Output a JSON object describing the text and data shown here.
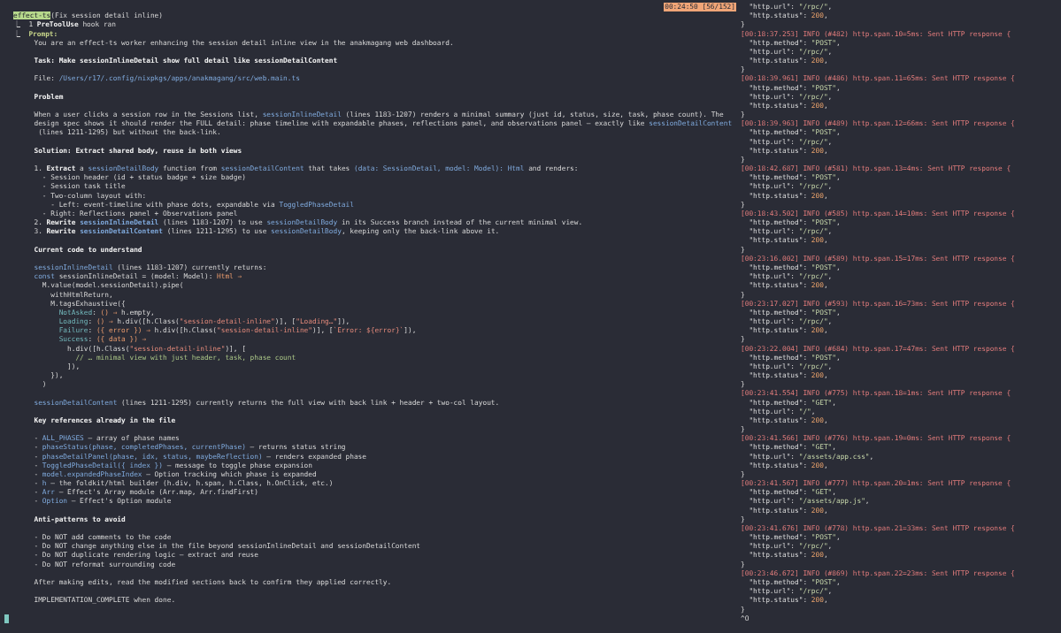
{
  "prompt_pane": {
    "status_badge": "00:24:50 [56/152]",
    "lines": [
      {
        "kind": "text",
        "parts": [
          {
            "text": "effect-ts",
            "kind": "highlight"
          },
          {
            "text": "(Fix session detail inline)",
            "kind": "plain"
          }
        ]
      },
      {
        "kind": "text",
        "parts": [
          {
            "text": "⎿  1 ",
            "kind": "plain"
          },
          {
            "text": "PreToolUse",
            "kind": "bold"
          },
          {
            "text": " hook ran",
            "kind": "plain"
          }
        ]
      },
      {
        "kind": "text",
        "parts": [
          {
            "text": "⎿  ",
            "kind": "plain"
          },
          {
            "text": "Prompt:",
            "kind": "prompt"
          }
        ]
      },
      {
        "kind": "text",
        "parts": [
          {
            "text": "     You are an effect-ts worker enhancing the session detail inline view in the anakmagang web dashboard.",
            "kind": "plain"
          }
        ]
      },
      {
        "kind": "blank"
      },
      {
        "kind": "text",
        "parts": [
          {
            "text": "     Task: Make sessionInlineDetail show full detail like sessionDetailContent",
            "kind": "bold"
          }
        ]
      },
      {
        "kind": "blank"
      },
      {
        "kind": "text",
        "parts": [
          {
            "text": "     File: ",
            "kind": "plain"
          },
          {
            "text": "/Users/r17/.config/nixpkgs/apps/anakmagang/src/web.main.ts",
            "kind": "ident"
          }
        ]
      },
      {
        "kind": "blank"
      },
      {
        "kind": "text",
        "parts": [
          {
            "text": "     Problem",
            "kind": "bold"
          }
        ]
      },
      {
        "kind": "blank"
      },
      {
        "kind": "text",
        "parts": [
          {
            "text": "     When a user clicks a session row in the Sessions list, ",
            "kind": "plain"
          },
          {
            "text": "sessionInlineDetail",
            "kind": "ident"
          },
          {
            "text": " (lines 1183-1207) renders a minimal summary (just id, status, size, task, phase count). The",
            "kind": "plain"
          }
        ]
      },
      {
        "kind": "text",
        "parts": [
          {
            "text": "     design spec shows it should render the FULL detail: phase timeline with expandable phases, reflections panel, and observations panel — exactly like ",
            "kind": "plain"
          },
          {
            "text": "sessionDetailContent",
            "kind": "ident"
          }
        ]
      },
      {
        "kind": "text",
        "parts": [
          {
            "text": "      (lines 1211-1295) but without the back-link.",
            "kind": "plain"
          }
        ]
      },
      {
        "kind": "blank"
      },
      {
        "kind": "text",
        "parts": [
          {
            "text": "     Solution: Extract shared body, reuse in both views",
            "kind": "bold"
          }
        ]
      },
      {
        "kind": "blank"
      },
      {
        "kind": "text",
        "parts": [
          {
            "text": "     1. ",
            "kind": "plain"
          },
          {
            "text": "Extract",
            "kind": "bold"
          },
          {
            "text": " a ",
            "kind": "plain"
          },
          {
            "text": "sessionDetailBody",
            "kind": "ident"
          },
          {
            "text": " function from ",
            "kind": "plain"
          },
          {
            "text": "sessionDetailContent",
            "kind": "ident"
          },
          {
            "text": " that takes ",
            "kind": "plain"
          },
          {
            "text": "(data: SessionDetail, model: Model): Html",
            "kind": "ident"
          },
          {
            "text": " and renders:",
            "kind": "plain"
          }
        ]
      },
      {
        "kind": "text",
        "parts": [
          {
            "text": "       - Session header (id + status badge + size badge)",
            "kind": "plain"
          }
        ]
      },
      {
        "kind": "text",
        "parts": [
          {
            "text": "       - Session task title",
            "kind": "plain"
          }
        ]
      },
      {
        "kind": "text",
        "parts": [
          {
            "text": "       - Two-column layout with:",
            "kind": "plain"
          }
        ]
      },
      {
        "kind": "text",
        "parts": [
          {
            "text": "         - Left: event-timeline with phase dots, expandable via ",
            "kind": "plain"
          },
          {
            "text": "ToggledPhaseDetail",
            "kind": "ident"
          }
        ]
      },
      {
        "kind": "text",
        "parts": [
          {
            "text": "       - Right: Reflections panel + Observations panel",
            "kind": "plain"
          }
        ]
      },
      {
        "kind": "text",
        "parts": [
          {
            "text": "     2. ",
            "kind": "plain"
          },
          {
            "text": "Rewrite ",
            "kind": "bold"
          },
          {
            "text": "sessionInlineDetail",
            "kind": "ident_bold"
          },
          {
            "text": " (lines 1183-1207) to use ",
            "kind": "plain"
          },
          {
            "text": "sessionDetailBody",
            "kind": "ident"
          },
          {
            "text": " in its Success branch instead of the current minimal view.",
            "kind": "plain"
          }
        ]
      },
      {
        "kind": "text",
        "parts": [
          {
            "text": "     3. ",
            "kind": "plain"
          },
          {
            "text": "Rewrite ",
            "kind": "bold"
          },
          {
            "text": "sessionDetailContent",
            "kind": "ident_bold"
          },
          {
            "text": " (lines 1211-1295) to use ",
            "kind": "plain"
          },
          {
            "text": "sessionDetailBody",
            "kind": "ident"
          },
          {
            "text": ", keeping only the back-link above it.",
            "kind": "plain"
          }
        ]
      },
      {
        "kind": "blank"
      },
      {
        "kind": "text",
        "parts": [
          {
            "text": "     Current code to understand",
            "kind": "bold"
          }
        ]
      },
      {
        "kind": "blank"
      },
      {
        "kind": "text",
        "parts": [
          {
            "text": "     sessionInlineDetail",
            "kind": "ident"
          },
          {
            "text": " (lines 1183-1207) currently returns:",
            "kind": "plain"
          }
        ]
      },
      {
        "kind": "text",
        "parts": [
          {
            "text": "     const",
            "kind": "ident"
          },
          {
            "text": " sessionInlineDetail = (model: Model): ",
            "kind": "plain"
          },
          {
            "text": "Html ⇒",
            "kind": "arrow"
          }
        ]
      },
      {
        "kind": "text",
        "parts": [
          {
            "text": "       M.value(model.sessionDetail).pipe(",
            "kind": "plain"
          }
        ]
      },
      {
        "kind": "text",
        "parts": [
          {
            "text": "         withHtmlReturn,",
            "kind": "plain"
          }
        ]
      },
      {
        "kind": "text",
        "parts": [
          {
            "text": "         M.tagsExhaustive({",
            "kind": "plain"
          }
        ]
      },
      {
        "kind": "text",
        "parts": [
          {
            "text": "           NotAsked",
            "kind": "tag"
          },
          {
            "text": ": ",
            "kind": "plain"
          },
          {
            "text": "() ⇒",
            "kind": "arrow"
          },
          {
            "text": " h.empty,",
            "kind": "plain"
          }
        ]
      },
      {
        "kind": "text",
        "parts": [
          {
            "text": "           Loading",
            "kind": "tag"
          },
          {
            "text": ": ",
            "kind": "plain"
          },
          {
            "text": "() ⇒",
            "kind": "arrow"
          },
          {
            "text": " h.div([h.Class(",
            "kind": "plain"
          },
          {
            "text": "\"session-detail-inline\"",
            "kind": "string"
          },
          {
            "text": ")], [",
            "kind": "plain"
          },
          {
            "text": "\"Loading…\"",
            "kind": "string"
          },
          {
            "text": "]),",
            "kind": "plain"
          }
        ]
      },
      {
        "kind": "text",
        "parts": [
          {
            "text": "           Failure",
            "kind": "tag"
          },
          {
            "text": ": ",
            "kind": "plain"
          },
          {
            "text": "({ error }) ⇒",
            "kind": "arrow"
          },
          {
            "text": " h.div([h.Class(",
            "kind": "plain"
          },
          {
            "text": "\"session-detail-inline\"",
            "kind": "string"
          },
          {
            "text": ")], [",
            "kind": "plain"
          },
          {
            "text": "`Error: ${error}`",
            "kind": "string"
          },
          {
            "text": "]),",
            "kind": "plain"
          }
        ]
      },
      {
        "kind": "text",
        "parts": [
          {
            "text": "           Success",
            "kind": "tag"
          },
          {
            "text": ": ",
            "kind": "plain"
          },
          {
            "text": "({ data }) ⇒",
            "kind": "arrow"
          }
        ]
      },
      {
        "kind": "text",
        "parts": [
          {
            "text": "             h.div([h.Class(",
            "kind": "plain"
          },
          {
            "text": "\"session-detail-inline\"",
            "kind": "string"
          },
          {
            "text": ")], [",
            "kind": "plain"
          }
        ]
      },
      {
        "kind": "text",
        "parts": [
          {
            "text": "               // … minimal view with just header, task, phase count",
            "kind": "comment"
          }
        ]
      },
      {
        "kind": "text",
        "parts": [
          {
            "text": "             ]),",
            "kind": "plain"
          }
        ]
      },
      {
        "kind": "text",
        "parts": [
          {
            "text": "         }),",
            "kind": "plain"
          }
        ]
      },
      {
        "kind": "text",
        "parts": [
          {
            "text": "       )",
            "kind": "plain"
          }
        ]
      },
      {
        "kind": "blank"
      },
      {
        "kind": "text",
        "parts": [
          {
            "text": "     sessionDetailContent",
            "kind": "ident"
          },
          {
            "text": " (lines 1211-1295) currently returns the full view with back link + header + two-col layout.",
            "kind": "plain"
          }
        ]
      },
      {
        "kind": "blank"
      },
      {
        "kind": "text",
        "parts": [
          {
            "text": "     Key references already in the file",
            "kind": "bold"
          }
        ]
      },
      {
        "kind": "blank"
      },
      {
        "kind": "text",
        "parts": [
          {
            "text": "     - ",
            "kind": "plain"
          },
          {
            "text": "ALL_PHASES",
            "kind": "ident"
          },
          {
            "text": " — array of phase names",
            "kind": "plain"
          }
        ]
      },
      {
        "kind": "text",
        "parts": [
          {
            "text": "     - ",
            "kind": "plain"
          },
          {
            "text": "phaseStatus(phase, completedPhases, currentPhase)",
            "kind": "ident"
          },
          {
            "text": " — returns status string",
            "kind": "plain"
          }
        ]
      },
      {
        "kind": "text",
        "parts": [
          {
            "text": "     - ",
            "kind": "plain"
          },
          {
            "text": "phaseDetailPanel(phase, idx, status, maybeReflection)",
            "kind": "ident"
          },
          {
            "text": " — renders expanded phase",
            "kind": "plain"
          }
        ]
      },
      {
        "kind": "text",
        "parts": [
          {
            "text": "     - ",
            "kind": "plain"
          },
          {
            "text": "ToggledPhaseDetail({ index })",
            "kind": "ident"
          },
          {
            "text": " — message to toggle phase expansion",
            "kind": "plain"
          }
        ]
      },
      {
        "kind": "text",
        "parts": [
          {
            "text": "     - ",
            "kind": "plain"
          },
          {
            "text": "model.expandedPhaseIndex",
            "kind": "ident"
          },
          {
            "text": " — Option tracking which phase is expanded",
            "kind": "plain"
          }
        ]
      },
      {
        "kind": "text",
        "parts": [
          {
            "text": "     - ",
            "kind": "plain"
          },
          {
            "text": "h",
            "kind": "ident"
          },
          {
            "text": " — the foldkit/html builder (h.div, h.span, h.Class, h.OnClick, etc.)",
            "kind": "plain"
          }
        ]
      },
      {
        "kind": "text",
        "parts": [
          {
            "text": "     - ",
            "kind": "plain"
          },
          {
            "text": "Arr",
            "kind": "ident"
          },
          {
            "text": " — Effect's Array module (Arr.map, Arr.findFirst)",
            "kind": "plain"
          }
        ]
      },
      {
        "kind": "text",
        "parts": [
          {
            "text": "     - ",
            "kind": "plain"
          },
          {
            "text": "Option",
            "kind": "ident"
          },
          {
            "text": " — Effect's Option module",
            "kind": "plain"
          }
        ]
      },
      {
        "kind": "blank"
      },
      {
        "kind": "text",
        "parts": [
          {
            "text": "     Anti-patterns to avoid",
            "kind": "bold"
          }
        ]
      },
      {
        "kind": "blank"
      },
      {
        "kind": "text",
        "parts": [
          {
            "text": "     - Do NOT add comments to the code",
            "kind": "plain"
          }
        ]
      },
      {
        "kind": "text",
        "parts": [
          {
            "text": "     - Do NOT change anything else in the file beyond sessionInlineDetail and sessionDetailContent",
            "kind": "plain"
          }
        ]
      },
      {
        "kind": "text",
        "parts": [
          {
            "text": "     - Do NOT duplicate rendering logic — extract and reuse",
            "kind": "plain"
          }
        ]
      },
      {
        "kind": "text",
        "parts": [
          {
            "text": "     - Do NOT reformat surrounding code",
            "kind": "plain"
          }
        ]
      },
      {
        "kind": "blank"
      },
      {
        "kind": "text",
        "parts": [
          {
            "text": "     After making edits, read the modified sections back to confirm they applied correctly.",
            "kind": "plain"
          }
        ]
      },
      {
        "kind": "blank"
      },
      {
        "kind": "text",
        "parts": [
          {
            "text": "     IMPLEMENTATION_COMPLETE when done.",
            "kind": "plain"
          }
        ]
      },
      {
        "kind": "blank"
      },
      {
        "kind": "cursor"
      }
    ]
  },
  "log_pane": {
    "lines": [
      {
        "kind": "text",
        "parts": [
          {
            "text": "  \"http.url\": ",
            "kind": "key"
          },
          {
            "text": "\"/rpc/\"",
            "kind": "value"
          },
          {
            "text": ",",
            "kind": "plain"
          }
        ]
      },
      {
        "kind": "text",
        "parts": [
          {
            "text": "  \"http.status\": ",
            "kind": "key"
          },
          {
            "text": "200",
            "kind": "number"
          },
          {
            "text": ",",
            "kind": "plain"
          }
        ]
      },
      {
        "kind": "text",
        "parts": [
          {
            "text": "}",
            "kind": "plain"
          }
        ]
      },
      {
        "kind": "text",
        "parts": [
          {
            "text": "[00:18:37.253] INFO (#482) http.span.10=5ms: Sent HTTP response {",
            "kind": "log_head"
          }
        ]
      },
      {
        "kind": "text",
        "parts": [
          {
            "text": "  \"http.method\": ",
            "kind": "key"
          },
          {
            "text": "\"POST\"",
            "kind": "value"
          },
          {
            "text": ",",
            "kind": "plain"
          }
        ]
      },
      {
        "kind": "text",
        "parts": [
          {
            "text": "  \"http.url\": ",
            "kind": "key"
          },
          {
            "text": "\"/rpc/\"",
            "kind": "value"
          },
          {
            "text": ",",
            "kind": "plain"
          }
        ]
      },
      {
        "kind": "text",
        "parts": [
          {
            "text": "  \"http.status\": ",
            "kind": "key"
          },
          {
            "text": "200",
            "kind": "number"
          },
          {
            "text": ",",
            "kind": "plain"
          }
        ]
      },
      {
        "kind": "text",
        "parts": [
          {
            "text": "}",
            "kind": "plain"
          }
        ]
      },
      {
        "kind": "text",
        "parts": [
          {
            "text": "[00:18:39.961] INFO (#486) http.span.11=65ms: Sent HTTP response {",
            "kind": "log_head"
          }
        ]
      },
      {
        "kind": "text",
        "parts": [
          {
            "text": "  \"http.method\": ",
            "kind": "key"
          },
          {
            "text": "\"POST\"",
            "kind": "value"
          },
          {
            "text": ",",
            "kind": "plain"
          }
        ]
      },
      {
        "kind": "text",
        "parts": [
          {
            "text": "  \"http.url\": ",
            "kind": "key"
          },
          {
            "text": "\"/rpc/\"",
            "kind": "value"
          },
          {
            "text": ",",
            "kind": "plain"
          }
        ]
      },
      {
        "kind": "text",
        "parts": [
          {
            "text": "  \"http.status\": ",
            "kind": "key"
          },
          {
            "text": "200",
            "kind": "number"
          },
          {
            "text": ",",
            "kind": "plain"
          }
        ]
      },
      {
        "kind": "text",
        "parts": [
          {
            "text": "}",
            "kind": "plain"
          }
        ]
      },
      {
        "kind": "text",
        "parts": [
          {
            "text": "[00:18:39.963] INFO (#489) http.span.12=66ms: Sent HTTP response {",
            "kind": "log_head"
          }
        ]
      },
      {
        "kind": "text",
        "parts": [
          {
            "text": "  \"http.method\": ",
            "kind": "key"
          },
          {
            "text": "\"POST\"",
            "kind": "value"
          },
          {
            "text": ",",
            "kind": "plain"
          }
        ]
      },
      {
        "kind": "text",
        "parts": [
          {
            "text": "  \"http.url\": ",
            "kind": "key"
          },
          {
            "text": "\"/rpc/\"",
            "kind": "value"
          },
          {
            "text": ",",
            "kind": "plain"
          }
        ]
      },
      {
        "kind": "text",
        "parts": [
          {
            "text": "  \"http.status\": ",
            "kind": "key"
          },
          {
            "text": "200",
            "kind": "number"
          },
          {
            "text": ",",
            "kind": "plain"
          }
        ]
      },
      {
        "kind": "text",
        "parts": [
          {
            "text": "}",
            "kind": "plain"
          }
        ]
      },
      {
        "kind": "text",
        "parts": [
          {
            "text": "[00:18:42.687] INFO (#581) http.span.13=4ms: Sent HTTP response {",
            "kind": "log_head"
          }
        ]
      },
      {
        "kind": "text",
        "parts": [
          {
            "text": "  \"http.method\": ",
            "kind": "key"
          },
          {
            "text": "\"POST\"",
            "kind": "value"
          },
          {
            "text": ",",
            "kind": "plain"
          }
        ]
      },
      {
        "kind": "text",
        "parts": [
          {
            "text": "  \"http.url\": ",
            "kind": "key"
          },
          {
            "text": "\"/rpc/\"",
            "kind": "value"
          },
          {
            "text": ",",
            "kind": "plain"
          }
        ]
      },
      {
        "kind": "text",
        "parts": [
          {
            "text": "  \"http.status\": ",
            "kind": "key"
          },
          {
            "text": "200",
            "kind": "number"
          },
          {
            "text": ",",
            "kind": "plain"
          }
        ]
      },
      {
        "kind": "text",
        "parts": [
          {
            "text": "}",
            "kind": "plain"
          }
        ]
      },
      {
        "kind": "text",
        "parts": [
          {
            "text": "[00:18:43.502] INFO (#585) http.span.14=10ms: Sent HTTP response {",
            "kind": "log_head"
          }
        ]
      },
      {
        "kind": "text",
        "parts": [
          {
            "text": "  \"http.method\": ",
            "kind": "key"
          },
          {
            "text": "\"POST\"",
            "kind": "value"
          },
          {
            "text": ",",
            "kind": "plain"
          }
        ]
      },
      {
        "kind": "text",
        "parts": [
          {
            "text": "  \"http.url\": ",
            "kind": "key"
          },
          {
            "text": "\"/rpc/\"",
            "kind": "value"
          },
          {
            "text": ",",
            "kind": "plain"
          }
        ]
      },
      {
        "kind": "text",
        "parts": [
          {
            "text": "  \"http.status\": ",
            "kind": "key"
          },
          {
            "text": "200",
            "kind": "number"
          },
          {
            "text": ",",
            "kind": "plain"
          }
        ]
      },
      {
        "kind": "text",
        "parts": [
          {
            "text": "}",
            "kind": "plain"
          }
        ]
      },
      {
        "kind": "text",
        "parts": [
          {
            "text": "[00:23:16.002] INFO (#589) http.span.15=17ms: Sent HTTP response {",
            "kind": "log_head"
          }
        ]
      },
      {
        "kind": "text",
        "parts": [
          {
            "text": "  \"http.method\": ",
            "kind": "key"
          },
          {
            "text": "\"POST\"",
            "kind": "value"
          },
          {
            "text": ",",
            "kind": "plain"
          }
        ]
      },
      {
        "kind": "text",
        "parts": [
          {
            "text": "  \"http.url\": ",
            "kind": "key"
          },
          {
            "text": "\"/rpc/\"",
            "kind": "value"
          },
          {
            "text": ",",
            "kind": "plain"
          }
        ]
      },
      {
        "kind": "text",
        "parts": [
          {
            "text": "  \"http.status\": ",
            "kind": "key"
          },
          {
            "text": "200",
            "kind": "number"
          },
          {
            "text": ",",
            "kind": "plain"
          }
        ]
      },
      {
        "kind": "text",
        "parts": [
          {
            "text": "}",
            "kind": "plain"
          }
        ]
      },
      {
        "kind": "text",
        "parts": [
          {
            "text": "[00:23:17.027] INFO (#593) http.span.16=73ms: Sent HTTP response {",
            "kind": "log_head"
          }
        ]
      },
      {
        "kind": "text",
        "parts": [
          {
            "text": "  \"http.method\": ",
            "kind": "key"
          },
          {
            "text": "\"POST\"",
            "kind": "value"
          },
          {
            "text": ",",
            "kind": "plain"
          }
        ]
      },
      {
        "kind": "text",
        "parts": [
          {
            "text": "  \"http.url\": ",
            "kind": "key"
          },
          {
            "text": "\"/rpc/\"",
            "kind": "value"
          },
          {
            "text": ",",
            "kind": "plain"
          }
        ]
      },
      {
        "kind": "text",
        "parts": [
          {
            "text": "  \"http.status\": ",
            "kind": "key"
          },
          {
            "text": "200",
            "kind": "number"
          },
          {
            "text": ",",
            "kind": "plain"
          }
        ]
      },
      {
        "kind": "text",
        "parts": [
          {
            "text": "}",
            "kind": "plain"
          }
        ]
      },
      {
        "kind": "text",
        "parts": [
          {
            "text": "[00:23:22.004] INFO (#684) http.span.17=47ms: Sent HTTP response {",
            "kind": "log_head"
          }
        ]
      },
      {
        "kind": "text",
        "parts": [
          {
            "text": "  \"http.method\": ",
            "kind": "key"
          },
          {
            "text": "\"POST\"",
            "kind": "value"
          },
          {
            "text": ",",
            "kind": "plain"
          }
        ]
      },
      {
        "kind": "text",
        "parts": [
          {
            "text": "  \"http.url\": ",
            "kind": "key"
          },
          {
            "text": "\"/rpc/\"",
            "kind": "value"
          },
          {
            "text": ",",
            "kind": "plain"
          }
        ]
      },
      {
        "kind": "text",
        "parts": [
          {
            "text": "  \"http.status\": ",
            "kind": "key"
          },
          {
            "text": "200",
            "kind": "number"
          },
          {
            "text": ",",
            "kind": "plain"
          }
        ]
      },
      {
        "kind": "text",
        "parts": [
          {
            "text": "}",
            "kind": "plain"
          }
        ]
      },
      {
        "kind": "text",
        "parts": [
          {
            "text": "[00:23:41.554] INFO (#775) http.span.18=1ms: Sent HTTP response {",
            "kind": "log_head"
          }
        ]
      },
      {
        "kind": "text",
        "parts": [
          {
            "text": "  \"http.method\": ",
            "kind": "key"
          },
          {
            "text": "\"GET\"",
            "kind": "value"
          },
          {
            "text": ",",
            "kind": "plain"
          }
        ]
      },
      {
        "kind": "text",
        "parts": [
          {
            "text": "  \"http.url\": ",
            "kind": "key"
          },
          {
            "text": "\"/\"",
            "kind": "value"
          },
          {
            "text": ",",
            "kind": "plain"
          }
        ]
      },
      {
        "kind": "text",
        "parts": [
          {
            "text": "  \"http.status\": ",
            "kind": "key"
          },
          {
            "text": "200",
            "kind": "number"
          },
          {
            "text": ",",
            "kind": "plain"
          }
        ]
      },
      {
        "kind": "text",
        "parts": [
          {
            "text": "}",
            "kind": "plain"
          }
        ]
      },
      {
        "kind": "text",
        "parts": [
          {
            "text": "[00:23:41.566] INFO (#776) http.span.19=0ms: Sent HTTP response {",
            "kind": "log_head"
          }
        ]
      },
      {
        "kind": "text",
        "parts": [
          {
            "text": "  \"http.method\": ",
            "kind": "key"
          },
          {
            "text": "\"GET\"",
            "kind": "value"
          },
          {
            "text": ",",
            "kind": "plain"
          }
        ]
      },
      {
        "kind": "text",
        "parts": [
          {
            "text": "  \"http.url\": ",
            "kind": "key"
          },
          {
            "text": "\"/assets/app.css\"",
            "kind": "value"
          },
          {
            "text": ",",
            "kind": "plain"
          }
        ]
      },
      {
        "kind": "text",
        "parts": [
          {
            "text": "  \"http.status\": ",
            "kind": "key"
          },
          {
            "text": "200",
            "kind": "number"
          },
          {
            "text": ",",
            "kind": "plain"
          }
        ]
      },
      {
        "kind": "text",
        "parts": [
          {
            "text": "}",
            "kind": "plain"
          }
        ]
      },
      {
        "kind": "text",
        "parts": [
          {
            "text": "[00:23:41.567] INFO (#777) http.span.20=1ms: Sent HTTP response {",
            "kind": "log_head"
          }
        ]
      },
      {
        "kind": "text",
        "parts": [
          {
            "text": "  \"http.method\": ",
            "kind": "key"
          },
          {
            "text": "\"GET\"",
            "kind": "value"
          },
          {
            "text": ",",
            "kind": "plain"
          }
        ]
      },
      {
        "kind": "text",
        "parts": [
          {
            "text": "  \"http.url\": ",
            "kind": "key"
          },
          {
            "text": "\"/assets/app.js\"",
            "kind": "value"
          },
          {
            "text": ",",
            "kind": "plain"
          }
        ]
      },
      {
        "kind": "text",
        "parts": [
          {
            "text": "  \"http.status\": ",
            "kind": "key"
          },
          {
            "text": "200",
            "kind": "number"
          },
          {
            "text": ",",
            "kind": "plain"
          }
        ]
      },
      {
        "kind": "text",
        "parts": [
          {
            "text": "}",
            "kind": "plain"
          }
        ]
      },
      {
        "kind": "text",
        "parts": [
          {
            "text": "[00:23:41.676] INFO (#778) http.span.21=33ms: Sent HTTP response {",
            "kind": "log_head"
          }
        ]
      },
      {
        "kind": "text",
        "parts": [
          {
            "text": "  \"http.method\": ",
            "kind": "key"
          },
          {
            "text": "\"POST\"",
            "kind": "value"
          },
          {
            "text": ",",
            "kind": "plain"
          }
        ]
      },
      {
        "kind": "text",
        "parts": [
          {
            "text": "  \"http.url\": ",
            "kind": "key"
          },
          {
            "text": "\"/rpc/\"",
            "kind": "value"
          },
          {
            "text": ",",
            "kind": "plain"
          }
        ]
      },
      {
        "kind": "text",
        "parts": [
          {
            "text": "  \"http.status\": ",
            "kind": "key"
          },
          {
            "text": "200",
            "kind": "number"
          },
          {
            "text": ",",
            "kind": "plain"
          }
        ]
      },
      {
        "kind": "text",
        "parts": [
          {
            "text": "}",
            "kind": "plain"
          }
        ]
      },
      {
        "kind": "text",
        "parts": [
          {
            "text": "[00:23:46.672] INFO (#869) http.span.22=23ms: Sent HTTP response {",
            "kind": "log_head"
          }
        ]
      },
      {
        "kind": "text",
        "parts": [
          {
            "text": "  \"http.method\": ",
            "kind": "key"
          },
          {
            "text": "\"POST\"",
            "kind": "value"
          },
          {
            "text": ",",
            "kind": "plain"
          }
        ]
      },
      {
        "kind": "text",
        "parts": [
          {
            "text": "  \"http.url\": ",
            "kind": "key"
          },
          {
            "text": "\"/rpc/\"",
            "kind": "value"
          },
          {
            "text": ",",
            "kind": "plain"
          }
        ]
      },
      {
        "kind": "text",
        "parts": [
          {
            "text": "  \"http.status\": ",
            "kind": "key"
          },
          {
            "text": "200",
            "kind": "number"
          },
          {
            "text": ",",
            "kind": "plain"
          }
        ]
      },
      {
        "kind": "text",
        "parts": [
          {
            "text": "}",
            "kind": "plain"
          }
        ]
      },
      {
        "kind": "text",
        "parts": [
          {
            "text": "^O",
            "kind": "plain"
          }
        ]
      }
    ]
  }
}
